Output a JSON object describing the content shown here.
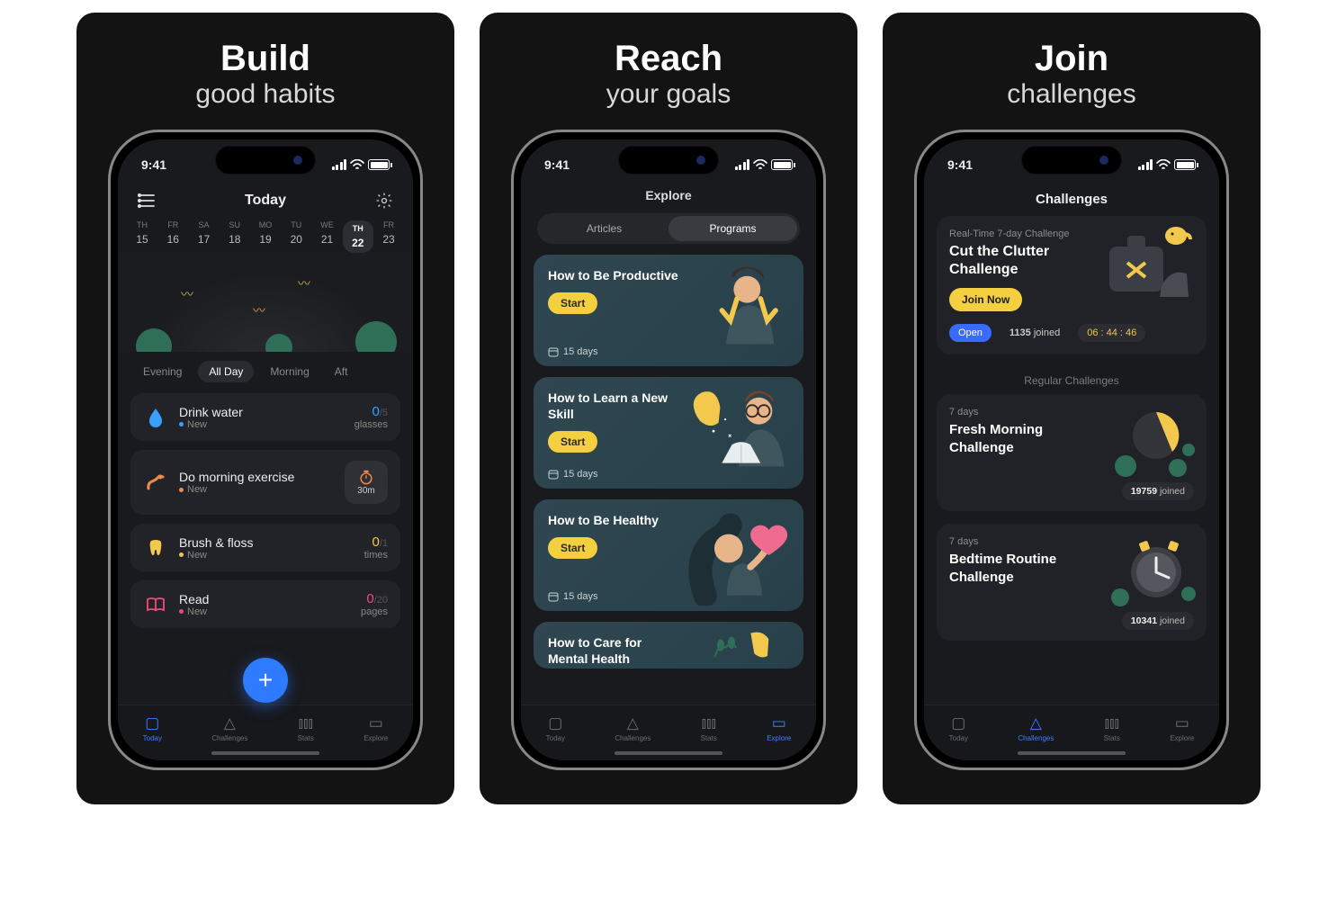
{
  "status_time": "9:41",
  "panels": [
    {
      "title": "Build",
      "subtitle": "good habits"
    },
    {
      "title": "Reach",
      "subtitle": "your goals"
    },
    {
      "title": "Join",
      "subtitle": "challenges"
    }
  ],
  "today": {
    "header_title": "Today",
    "week": [
      {
        "dow": "TH",
        "num": "15"
      },
      {
        "dow": "FR",
        "num": "16"
      },
      {
        "dow": "SA",
        "num": "17"
      },
      {
        "dow": "SU",
        "num": "18"
      },
      {
        "dow": "MO",
        "num": "19"
      },
      {
        "dow": "TU",
        "num": "20"
      },
      {
        "dow": "WE",
        "num": "21"
      },
      {
        "dow": "TH",
        "num": "22",
        "selected": true
      },
      {
        "dow": "FR",
        "num": "23"
      }
    ],
    "time_filters": [
      "Evening",
      "All Day",
      "Morning",
      "Aft"
    ],
    "time_filter_selected": "All Day",
    "habits": [
      {
        "icon": "drop-icon",
        "color": "#3aa0ff",
        "name": "Drink water",
        "status": "New",
        "dot": "#3aa0ff",
        "val": "0",
        "val_color": "#3aa0ff",
        "denom": "/5",
        "unit": "glasses"
      },
      {
        "icon": "exercise-icon",
        "color": "#ef8a4a",
        "name": "Do morning exercise",
        "status": "New",
        "dot": "#ef8a4a",
        "timer_label": "30m"
      },
      {
        "icon": "tooth-icon",
        "color": "#f2c94c",
        "name": "Brush & floss",
        "status": "New",
        "dot": "#f2c94c",
        "val": "0",
        "val_color": "#f2c94c",
        "denom": "/1",
        "unit": "times"
      },
      {
        "icon": "book-icon",
        "color": "#ef4a7b",
        "name": "Read",
        "status": "New",
        "dot": "#ef4a7b",
        "val": "0",
        "val_color": "#ef4a7b",
        "denom": "/20",
        "unit": "pages"
      }
    ]
  },
  "explore": {
    "header_title": "Explore",
    "segments": [
      "Articles",
      "Programs"
    ],
    "segment_selected": "Programs",
    "programs": [
      {
        "title": "How to Be Productive",
        "duration": "15 days",
        "start": "Start"
      },
      {
        "title": "How to Learn a New Skill",
        "duration": "15 days",
        "start": "Start"
      },
      {
        "title": "How to Be Healthy",
        "duration": "15 days",
        "start": "Start"
      },
      {
        "title": "How to Care for Mental Health"
      }
    ]
  },
  "challenges": {
    "header_title": "Challenges",
    "featured": {
      "tag": "Real-Time 7-day Challenge",
      "title": "Cut the Clutter Challenge",
      "join": "Join Now",
      "open_label": "Open",
      "joined_count": "1135",
      "joined_suffix": " joined",
      "countdown": "06 : 44 : 46"
    },
    "regular_label": "Regular Challenges",
    "regular": [
      {
        "tag": "7 days",
        "title": "Fresh Morning Challenge",
        "joined": "19759",
        "joined_suffix": " joined"
      },
      {
        "tag": "7 days",
        "title": "Bedtime Routine Challenge",
        "joined": "10341",
        "joined_suffix": " joined"
      }
    ]
  },
  "tabs": [
    {
      "label": "Today",
      "icon": "square-icon"
    },
    {
      "label": "Challenges",
      "icon": "mountain-icon"
    },
    {
      "label": "Stats",
      "icon": "bars-icon"
    },
    {
      "label": "Explore",
      "icon": "bookopen-icon"
    }
  ]
}
